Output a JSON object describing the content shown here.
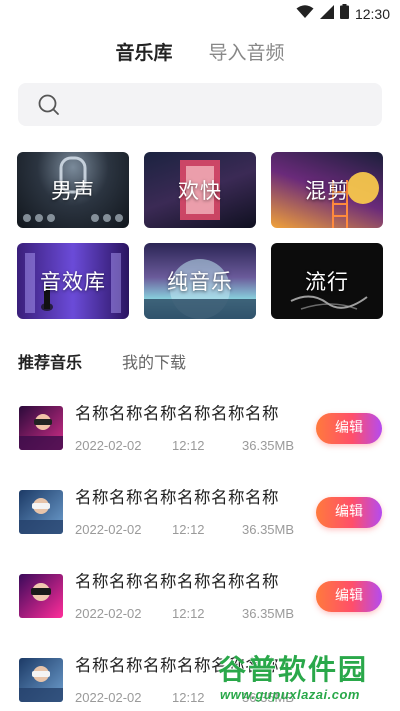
{
  "status_bar": {
    "time": "12:30",
    "icons": [
      "wifi-icon",
      "signal-icon",
      "battery-icon"
    ]
  },
  "top_tabs": [
    {
      "label": "音乐库",
      "active": true
    },
    {
      "label": "导入音频",
      "active": false
    }
  ],
  "search": {
    "placeholder": "",
    "icon": "search-icon"
  },
  "categories": [
    {
      "label": "男声"
    },
    {
      "label": "欢快"
    },
    {
      "label": "混剪"
    },
    {
      "label": "音效库"
    },
    {
      "label": "纯音乐"
    },
    {
      "label": "流行"
    }
  ],
  "sub_tabs": [
    {
      "label": "推荐音乐",
      "active": true
    },
    {
      "label": "我的下载",
      "active": false
    }
  ],
  "songs": [
    {
      "title": "名称名称名称名称名称名称",
      "date": "2022-02-02",
      "time": "12:12",
      "size": "36.35MB",
      "action": "编辑"
    },
    {
      "title": "名称名称名称名称名称名称",
      "date": "2022-02-02",
      "time": "12:12",
      "size": "36.35MB",
      "action": "编辑"
    },
    {
      "title": "名称名称名称名称名称名称",
      "date": "2022-02-02",
      "time": "12:12",
      "size": "36.35MB",
      "action": "编辑"
    },
    {
      "title": "名称名称名称名称名称名称",
      "date": "2022-02-02",
      "time": "12:12",
      "size": "36.35MB",
      "action": ""
    }
  ],
  "watermark": {
    "title": "谷普软件园",
    "url": "www.gupuxlazai.com"
  },
  "colors": {
    "accent_gradient": [
      "#ff7a3d",
      "#ff4e6a",
      "#b44bf0"
    ],
    "watermark_green": "#2aa84a"
  }
}
